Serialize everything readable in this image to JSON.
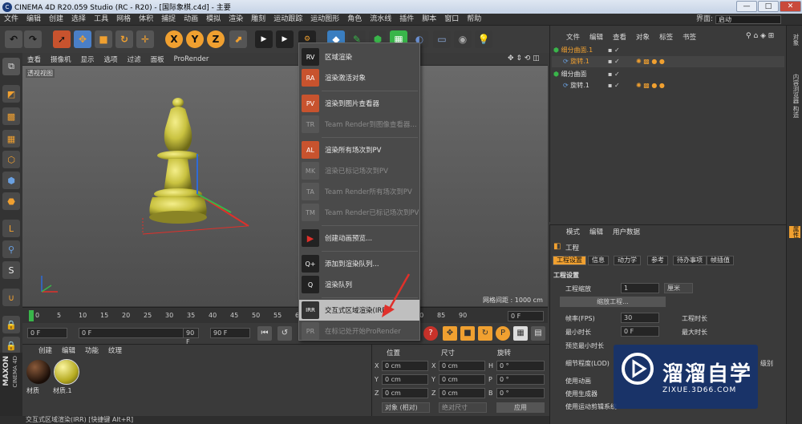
{
  "window": {
    "title": "CINEMA 4D R20.059 Studio (RC - R20) - [国际象棋.c4d] - 主要",
    "app_icon": "C",
    "minimize": "—",
    "maximize": "□",
    "close": "✕"
  },
  "menubar": {
    "items": [
      "文件",
      "编辑",
      "创建",
      "选择",
      "工具",
      "网格",
      "体积",
      "捕捉",
      "动画",
      "模拟",
      "渲染",
      "雕刻",
      "运动跟踪",
      "运动图形",
      "角色",
      "流水线",
      "插件",
      "脚本",
      "窗口",
      "帮助"
    ],
    "layout_label": "界面:",
    "layout_value": "启动"
  },
  "toolbar": {
    "axis_x": "X",
    "axis_y": "Y",
    "axis_z": "Z"
  },
  "viewport": {
    "menu": [
      "查看",
      "摄像机",
      "显示",
      "选项",
      "过滤",
      "面板",
      "ProRender"
    ],
    "label": "透视视图",
    "grid_info": "网格间距 : 1000 cm"
  },
  "timeline": {
    "ticks": [
      "0",
      "5",
      "10",
      "15",
      "20",
      "25",
      "30",
      "35",
      "40",
      "45",
      "50",
      "55",
      "60",
      "65",
      "70",
      "75",
      "80",
      "85",
      "90"
    ],
    "end_frame": "0 F"
  },
  "anim": {
    "start": "0 F",
    "current": "0 F",
    "end": "90 F",
    "end2": "90 F"
  },
  "materials": {
    "menu": [
      "创建",
      "编辑",
      "功能",
      "纹理"
    ],
    "items": [
      {
        "name": "材质"
      },
      {
        "name": "材质.1"
      }
    ]
  },
  "coords": {
    "headers": [
      "位置",
      "尺寸",
      "旋转"
    ],
    "rows": [
      {
        "axis": "X",
        "pos": "0 cm",
        "size_axis": "X",
        "size": "0 cm",
        "rot_axis": "H",
        "rot": "0 °"
      },
      {
        "axis": "Y",
        "pos": "0 cm",
        "size_axis": "Y",
        "size": "0 cm",
        "rot_axis": "P",
        "rot": "0 °"
      },
      {
        "axis": "Z",
        "pos": "0 cm",
        "size_axis": "Z",
        "size": "0 cm",
        "rot_axis": "B",
        "rot": "0 °"
      }
    ],
    "mode": "对象 (相对)",
    "size_mode": "绝对尺寸",
    "apply": "应用"
  },
  "dropdown": {
    "items": [
      {
        "label": "区域渲染",
        "icon": "RV"
      },
      {
        "label": "渲染激活对象",
        "icon": "RA"
      },
      {
        "label": "渲染到图片查看器",
        "icon": "PV"
      },
      {
        "label": "Team Render到图像查看器...",
        "icon": "TR"
      },
      {
        "label": "渲染所有场次到PV",
        "icon": "AL"
      },
      {
        "label": "渲染已标记场次到PV",
        "icon": "MK"
      },
      {
        "label": "Team Render所有场次到PV",
        "icon": "TA"
      },
      {
        "label": "Team Render已标记场次到PV",
        "icon": "TM"
      },
      {
        "label": "创建动画预览...",
        "icon": "▶"
      },
      {
        "label": "添加到渲染队列...",
        "icon": "Q+"
      },
      {
        "label": "渲染队列",
        "icon": "Q"
      },
      {
        "label": "交互式区域渲染(IRR)",
        "icon": "IRR"
      },
      {
        "label": "在标记处开始ProRender",
        "icon": "PR"
      }
    ]
  },
  "objects": {
    "menu": [
      "文件",
      "编辑",
      "查看",
      "对象",
      "标签",
      "书签"
    ],
    "rows": [
      {
        "name": "细分曲面.1",
        "indent": 0
      },
      {
        "name": "旋转.1",
        "indent": 1
      },
      {
        "name": "细分曲面",
        "indent": 0
      },
      {
        "name": "旋转.1",
        "indent": 1
      }
    ]
  },
  "attributes": {
    "menu": [
      "模式",
      "编辑",
      "用户数据"
    ],
    "title": "工程",
    "tabs": [
      "工程设置",
      "信息",
      "动力学",
      "参考",
      "待办事项",
      "帧插值"
    ],
    "section": "工程设置",
    "scale_label": "工程缩放",
    "scale_value": "1",
    "scale_unit": "厘米",
    "scale_btn": "缩放工程...",
    "fps_label": "帧率(FPS)",
    "fps_value": "30",
    "duration_label": "工程时长",
    "min_label": "最小时长",
    "min_value": "0 F",
    "max_label": "最大时长",
    "preview_min": "预览最小时长",
    "lod_label": "细节程度(LOD)",
    "lod_right": "级别",
    "use_anim": "使用动画",
    "use_gen": "使用生成器",
    "use_deform": "使用运动剪辑系统"
  },
  "rightstrip": [
    "对象",
    "内容浏览器",
    "构造",
    "属性"
  ],
  "statusbar": "交互式区域渲染(IRR) [快捷键 Alt+R]",
  "watermark": {
    "main": "溜溜自学",
    "sub": "ZIXUE.3D66.COM"
  },
  "brand": [
    "MAXON",
    "CINEMA 4D"
  ],
  "colors": {
    "accent": "#f0a030",
    "highlight": "#bfbfbf",
    "pawn": "#c9c240",
    "arrow": "#e0302a",
    "watermark": "#14326e"
  }
}
